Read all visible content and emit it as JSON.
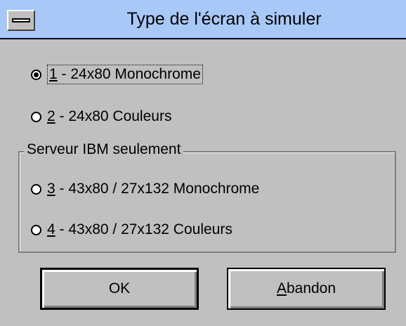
{
  "window": {
    "title": "Type de l'écran à simuler"
  },
  "options": [
    {
      "key": "1",
      "label": " - 24x80 Monochrome",
      "checked": true
    },
    {
      "key": "2",
      "label": " - 24x80 Couleurs",
      "checked": false
    }
  ],
  "group": {
    "label": "Serveur IBM seulement",
    "options": [
      {
        "key": "3",
        "label": " - 43x80 / 27x132 Monochrome",
        "checked": false
      },
      {
        "key": "4",
        "label": " - 43x80 / 27x132 Couleurs",
        "checked": false
      }
    ]
  },
  "buttons": {
    "ok_label": "OK",
    "cancel_mnemonic": "A",
    "cancel_rest": "bandon"
  }
}
